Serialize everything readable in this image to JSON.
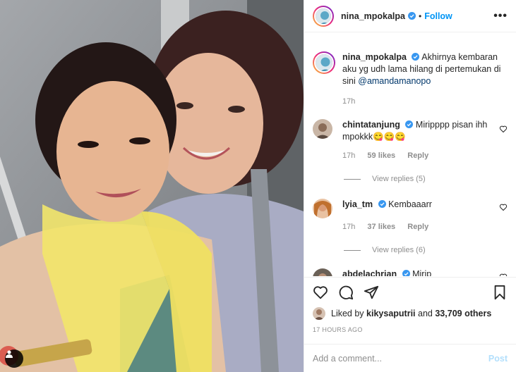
{
  "header": {
    "username": "nina_mpokalpa",
    "dot": "•",
    "follow_label": "Follow",
    "more_label": "•••"
  },
  "caption": {
    "username": "nina_mpokalpa",
    "text": "Akhirnya kembaran aku yg udh lama hilang di pertemukan di sini",
    "mention": "@amandamanopo",
    "time": "17h"
  },
  "comments": [
    {
      "username": "chintatanjung",
      "verified": true,
      "text": "Miripppp pisan ihh mpokkk😋😋😋",
      "time": "17h",
      "likes": "59 likes",
      "reply_label": "Reply",
      "view_replies": "View replies (5)"
    },
    {
      "username": "lyia_tm",
      "verified": true,
      "text": "Kembaaarr",
      "time": "17h",
      "likes": "37 likes",
      "reply_label": "Reply",
      "view_replies": "View replies (6)"
    },
    {
      "username": "abdelachrian",
      "verified": true,
      "text": "Mirip",
      "time": "",
      "likes": "",
      "reply_label": "",
      "view_replies": ""
    }
  ],
  "liked": {
    "prefix": "Liked by ",
    "user": "kikysaputrii",
    "middle": " and ",
    "count": "33,709 others"
  },
  "timestamp": "17 HOURS AGO",
  "add_comment": {
    "placeholder": "Add a comment...",
    "post_label": "Post"
  },
  "colors": {
    "accent": "#0095f6",
    "verified": "#3897f0",
    "muted": "#8e8e8e",
    "post_disabled": "#b2dffc"
  },
  "icons": {
    "like": "heart-icon",
    "comment": "comment-bubble-icon",
    "share": "paper-plane-icon",
    "save": "bookmark-icon",
    "tag": "user-tag-icon"
  }
}
